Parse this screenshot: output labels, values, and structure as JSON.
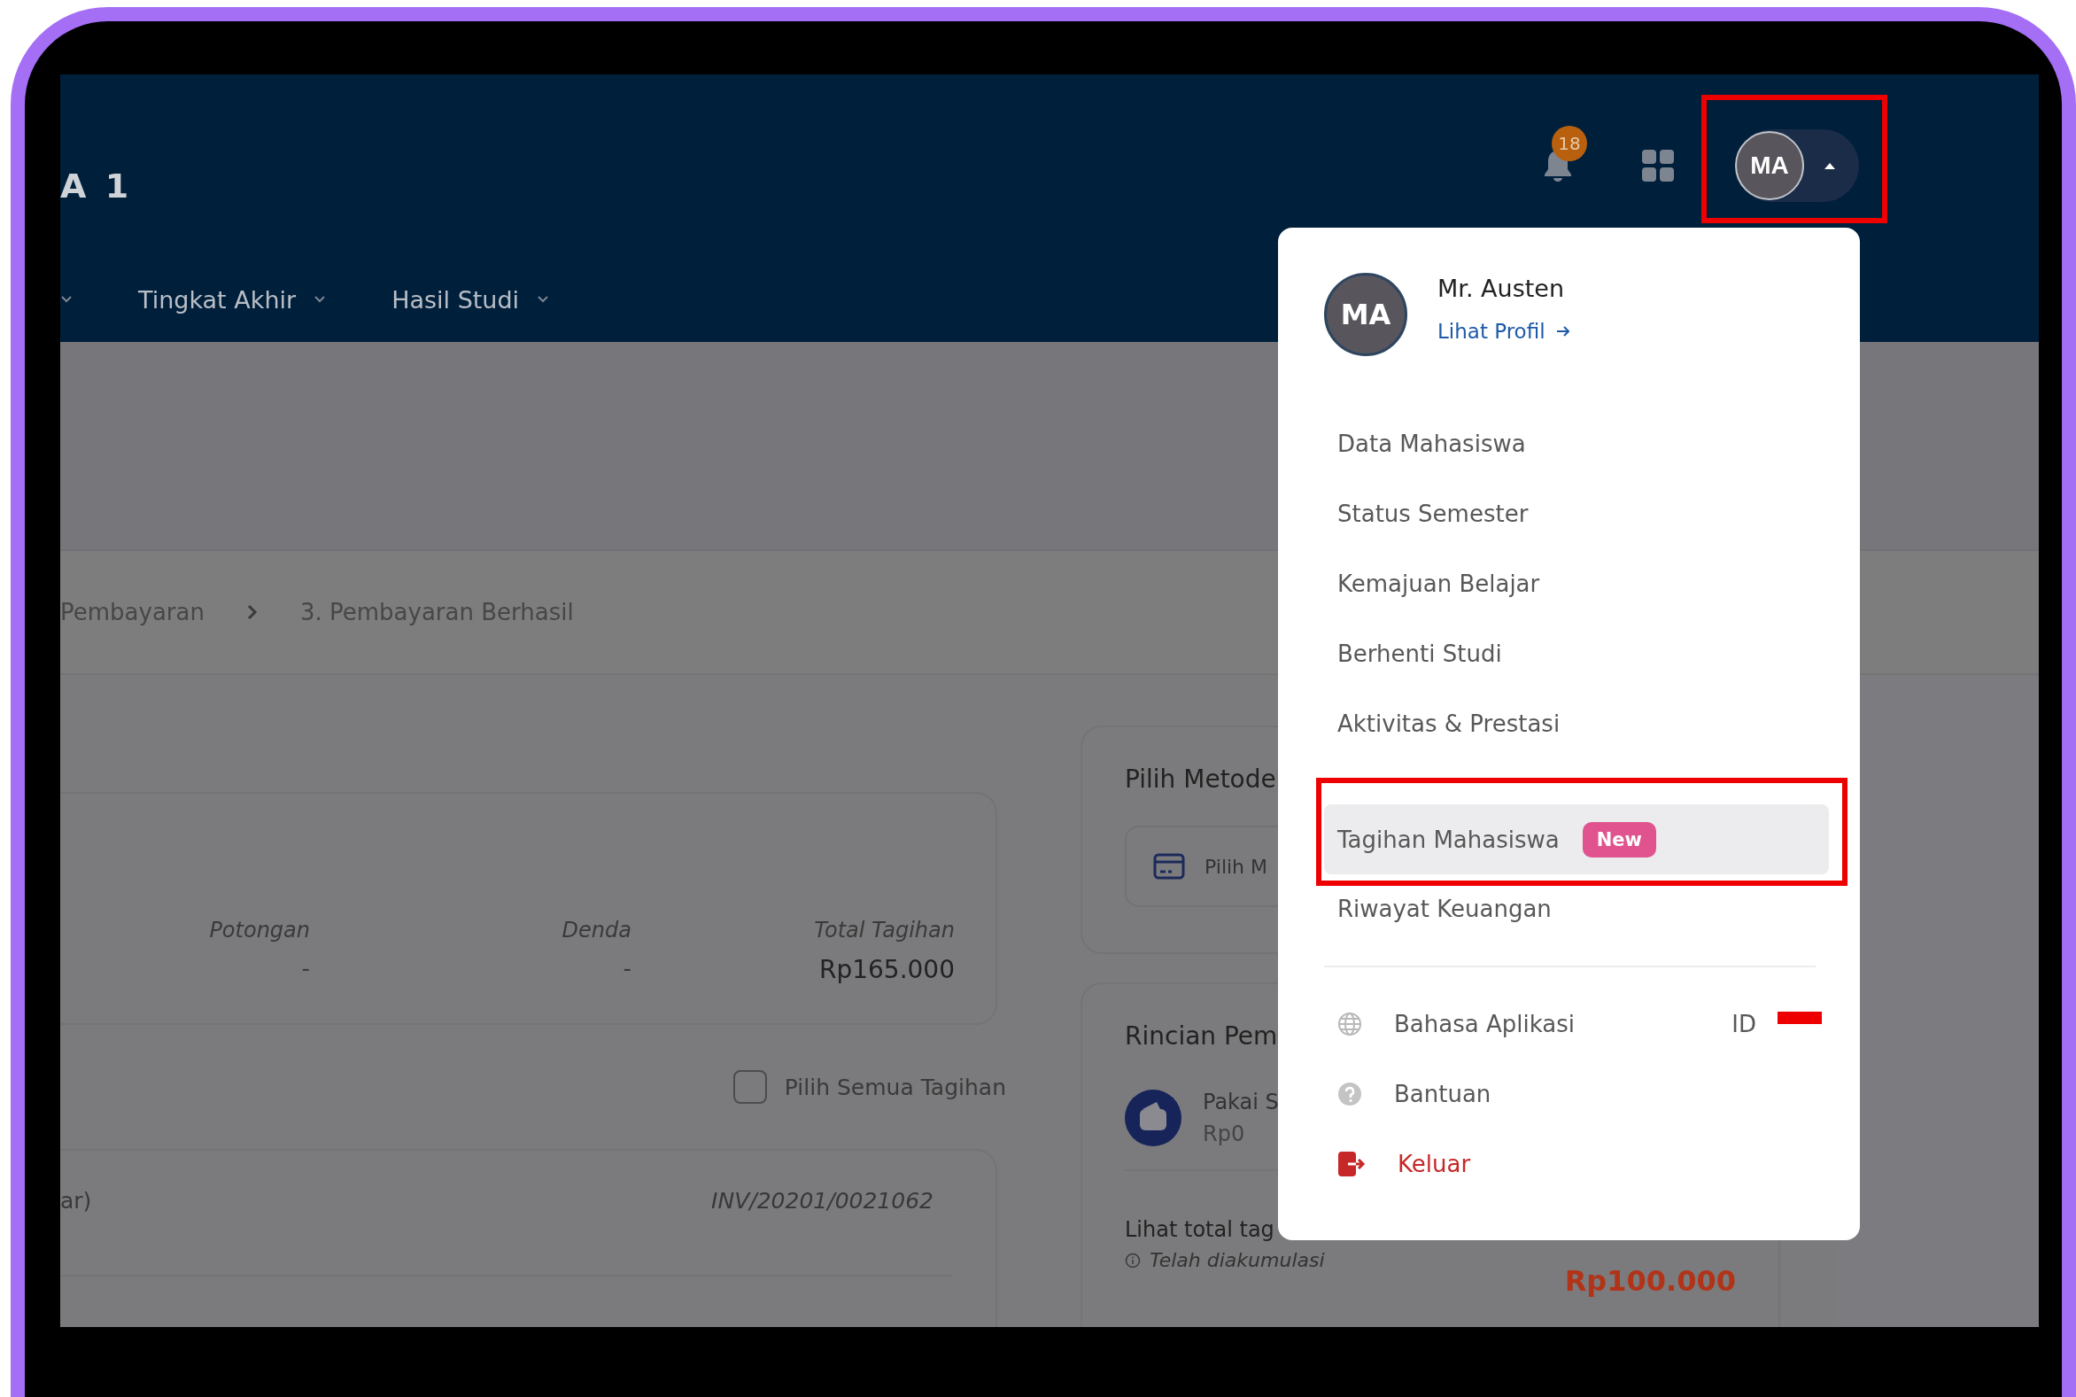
{
  "header": {
    "title": "A 1",
    "nav": [
      {
        "label": "Tingkat Akhir"
      },
      {
        "label": "Hasil Studi"
      }
    ],
    "notification_count": "18",
    "avatar_initials": "MA",
    "menu_open": true
  },
  "breadcrumb": [
    "Pembayaran",
    "3. Pembayaran Berhasil"
  ],
  "summary_card": {
    "columns": [
      {
        "label": "Potongan",
        "value": "-"
      },
      {
        "label": "Denda",
        "value": "-"
      },
      {
        "label": "Total Tagihan",
        "value": "Rp165.000"
      }
    ]
  },
  "select_all": {
    "label": "Pilih Semua Tagihan",
    "checked": false
  },
  "invoice_card": {
    "title": "ar)",
    "invoice": "INV/20201/0021062"
  },
  "payment_method": {
    "title": "Pilih Metode",
    "field": "Pilih M"
  },
  "payment_details": {
    "title": "Rincian Pem",
    "wallet_label": "Pakai S",
    "wallet_amount": "Rp0",
    "total_label": "Lihat total tag",
    "note": "Telah diakumulasi",
    "total": "Rp100.000"
  },
  "profile_menu": {
    "initials": "MA",
    "name": "Mr. Austen",
    "profile_link": "Lihat Profil",
    "items": [
      {
        "label": "Data Mahasiswa",
        "selected": false
      },
      {
        "label": "Status Semester",
        "selected": false
      },
      {
        "label": "Kemajuan Belajar",
        "selected": false
      },
      {
        "label": "Berhenti Studi",
        "selected": false
      },
      {
        "label": "Aktivitas & Prestasi",
        "selected": false
      },
      {
        "label": "Tagihan Mahasiswa",
        "selected": true,
        "badge": "New"
      },
      {
        "label": "Riwayat Keuangan",
        "selected": false
      }
    ],
    "settings": [
      {
        "kind": "language",
        "label": "Bahasa Aplikasi",
        "value": "ID"
      },
      {
        "kind": "help",
        "label": "Bantuan"
      },
      {
        "kind": "logout",
        "label": "Keluar"
      }
    ]
  }
}
